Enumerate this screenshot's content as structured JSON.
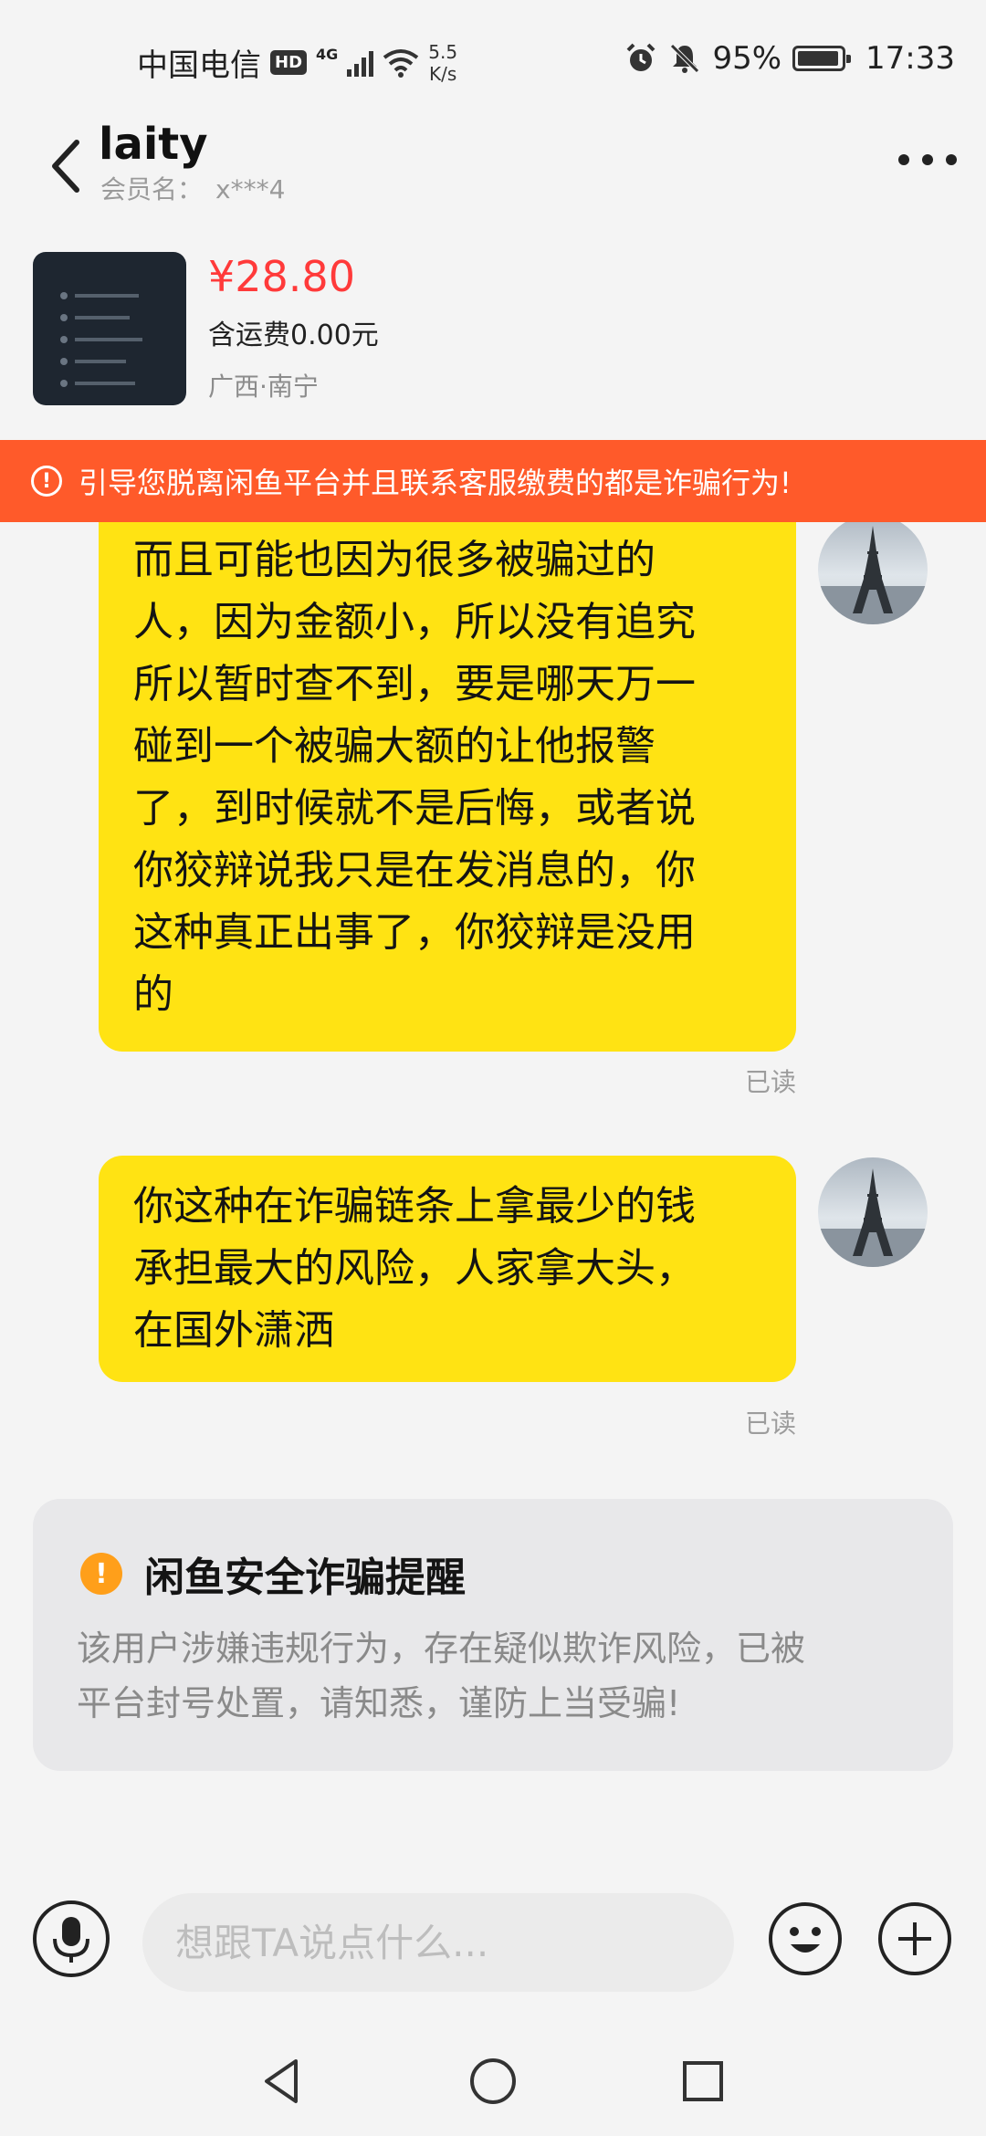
{
  "status_bar": {
    "carrier": "中国电信",
    "hd_badge": "HD",
    "network_type": "4G",
    "speed_value": "5.5",
    "speed_unit": "K/s",
    "battery_percent": "95%",
    "battery_level": 0.95,
    "time": "17:33",
    "icons": [
      "hd-icon",
      "signal-icon",
      "wifi-icon",
      "alarm-icon",
      "mute-icon",
      "battery-icon"
    ]
  },
  "header": {
    "title": "laity",
    "member_label": "会员名：",
    "member_value": "x***4",
    "icons": [
      "back-arrow-icon",
      "more-icon"
    ]
  },
  "product": {
    "price": "¥28.80",
    "shipping": "含运费0.00元",
    "location": "广西·南宁"
  },
  "warning_banner": {
    "icon": "!",
    "text": "引导您脱离闲鱼平台并且联系客服缴费的都是诈骗行为!"
  },
  "messages": [
    {
      "lines": [
        "而且可能也因为很多被骗过的",
        "人，因为金额小，所以没有追究",
        "所以暂时查不到，要是哪天万一",
        "碰到一个被骗大额的让他报警",
        "了，到时候就不是后悔，或者说",
        "你狡辩说我只是在发消息的，你",
        "这种真正出事了，你狡辩是没用",
        "的"
      ],
      "status": "已读"
    },
    {
      "lines": [
        "你这种在诈骗链条上拿最少的钱",
        "承担最大的风险，人家拿大头，",
        "在国外潇洒"
      ],
      "status": "已读"
    }
  ],
  "safety_card": {
    "icon": "!",
    "title": "闲鱼安全诈骗提醒",
    "lines": [
      "该用户涉嫌违规行为，存在疑似欺诈风险，已被",
      "平台封号处置，请知悉，谨防上当受骗!"
    ]
  },
  "input_bar": {
    "placeholder": "想跟TA说点什么...",
    "value": "",
    "icons": [
      "microphone-icon",
      "emoji-icon",
      "plus-icon"
    ]
  },
  "nav_bar": {
    "icons": [
      "nav-back-icon",
      "nav-home-icon",
      "nav-recent-icon"
    ]
  },
  "colors": {
    "bubble": "#ffe313",
    "price": "#ff3a3a",
    "warning_banner": "#ff5a2a",
    "safety_icon": "#ff9f1a"
  }
}
